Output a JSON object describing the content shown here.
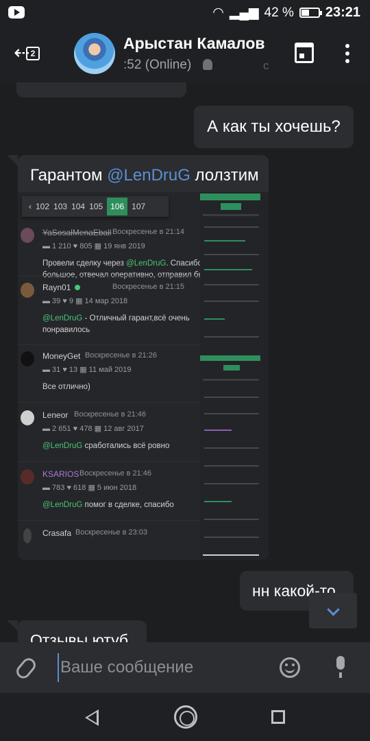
{
  "status_bar": {
    "battery": "42 %",
    "time": "23:21"
  },
  "header": {
    "contact_name": "Арыстан Камалов",
    "contact_status": ":52 (Online)",
    "faint_text": "с"
  },
  "messages": {
    "outgoing_1": "А как ты хочешь?",
    "incoming_caption_prefix": "Гарантом ",
    "incoming_caption_mention": "@LenDruG",
    "incoming_caption_suffix": " лолзтим",
    "outgoing_2": "нн какой-то",
    "incoming_2": "Отзывы ютуб"
  },
  "shot": {
    "pager": [
      "‹",
      "102",
      "103",
      "104",
      "105",
      "106",
      "107"
    ],
    "reviews": [
      {
        "name": "YaSosalMenaEball",
        "time": "Воскресенье в 21:14",
        "stats": "▬ 1 210   ♥ 805   ▦ 19 янв 2019",
        "text_pre": "Провели сделку через ",
        "mention": "@LenDruG",
        "text_post": ". Спасибо большое, отвечал оперативно, отправил быс"
      },
      {
        "name": "Rayn01",
        "time": "Воскресенье в 21:15",
        "stats": "▬ 39   ♥ 9   ▦ 14 мар 2018",
        "text_pre": "",
        "mention": "@LenDruG",
        "text_post": " - Отличный гарант,всё очень понравилось"
      },
      {
        "name": "MoneyGet",
        "time": "Воскресенье в 21:26",
        "stats": "▬ 31   ♥ 13   ▦ 11 май 2019",
        "text_pre": "Все отлично)",
        "mention": "",
        "text_post": ""
      },
      {
        "name": "Leneor",
        "time": "Воскресенье в 21:46",
        "stats": "▬ 2 651   ♥ 478   ▦ 12 авг 2017",
        "text_pre": "",
        "mention": "@LenDruG",
        "text_post": " сработались всё ровно"
      },
      {
        "name": "KSARIOS",
        "time": "Воскресенье в 21:46",
        "stats": "▬ 783   ♥ 618   ▦ 5 июн 2018",
        "text_pre": "",
        "mention": "@LenDruG",
        "text_post": " помог в сделке, спасибо"
      },
      {
        "name": "Crasafa",
        "time": "Воскресенье в 23:03",
        "stats": "",
        "text_pre": "",
        "mention": "",
        "text_post": ""
      }
    ]
  },
  "input": {
    "placeholder": "Ваше сообщение"
  }
}
